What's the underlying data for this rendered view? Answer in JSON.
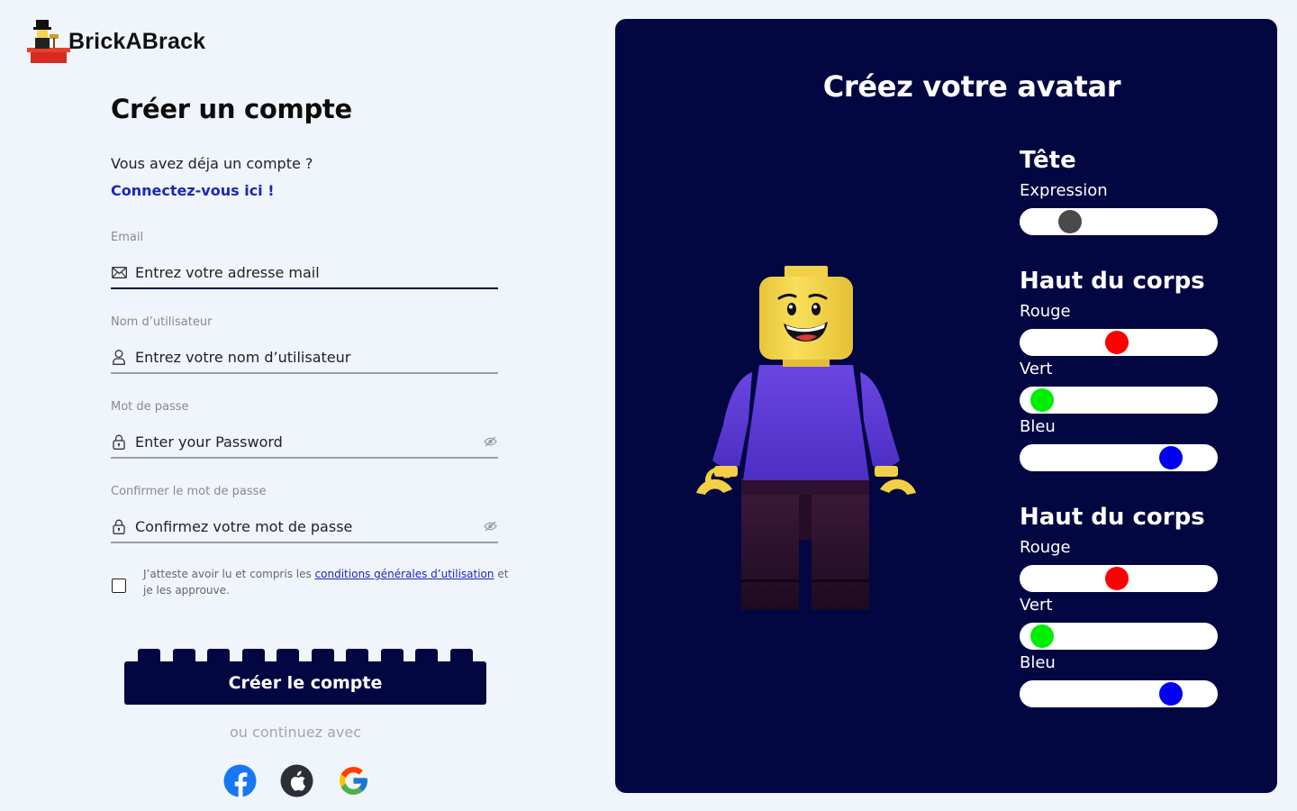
{
  "brand": {
    "name": "BrickABrack"
  },
  "form": {
    "title": "Créer un compte",
    "has_account": "Vous avez déja un compte ?",
    "login_link": "Connectez-vous ici !",
    "fields": {
      "email": {
        "label": "Email",
        "placeholder": "Entrez votre adresse mail",
        "icon": "envelope-icon"
      },
      "username": {
        "label": "Nom d’utilisateur",
        "placeholder": "Entrez votre nom d’utilisateur",
        "icon": "user-icon"
      },
      "password": {
        "label": "Mot de passe",
        "placeholder": "Enter your Password",
        "icon": "lock-icon"
      },
      "confirm": {
        "label": "Confirmer le mot de passe",
        "placeholder": "Confirmez votre mot de passe",
        "icon": "lock-icon"
      }
    },
    "terms": {
      "before": "J’atteste avoir lu et compris les ",
      "link": "conditions générales d’utilisation",
      "after": " et je les approuve."
    },
    "submit": "Créer le compte",
    "or_continue": "ou continuez avec",
    "social": [
      "facebook-icon",
      "apple-icon",
      "google-icon"
    ]
  },
  "avatar": {
    "title": "Créez votre avatar",
    "head": {
      "title": "Tête",
      "label": "Expression",
      "value": 0.22,
      "color": "#4a4a4a"
    },
    "torso": {
      "title": "Haut du corps",
      "sliders": [
        {
          "label": "Rouge",
          "value": 0.49,
          "color": "#ff0000"
        },
        {
          "label": "Vert",
          "value": 0.06,
          "color": "#00ee00"
        },
        {
          "label": "Bleu",
          "value": 0.8,
          "color": "#0000ee"
        }
      ]
    },
    "legs": {
      "title": "Haut du corps",
      "sliders": [
        {
          "label": "Rouge",
          "value": 0.49,
          "color": "#ff0000"
        },
        {
          "label": "Vert",
          "value": 0.06,
          "color": "#00ee00"
        },
        {
          "label": "Bleu",
          "value": 0.8,
          "color": "#0000ee"
        }
      ]
    }
  },
  "colors": {
    "panel": "#020742",
    "accent": "#1b27b8",
    "torso": "#5b3ad6",
    "legs": "#2a0f2e",
    "skin": "#f5d54a"
  }
}
